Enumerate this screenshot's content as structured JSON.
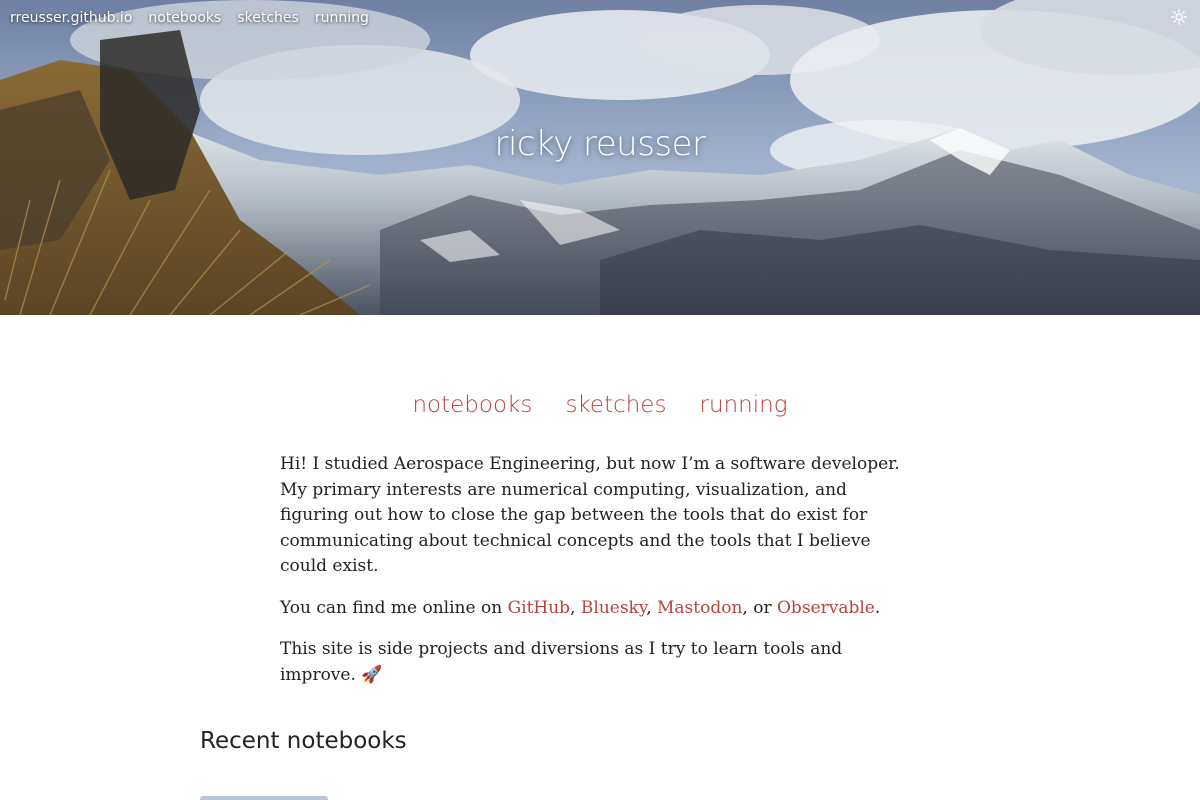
{
  "topnav": {
    "site": "rreusser.github.io",
    "items": [
      "notebooks",
      "sketches",
      "running"
    ]
  },
  "hero": {
    "title": "ricky reusser"
  },
  "main_nav": {
    "items": [
      "notebooks",
      "sketches",
      "running"
    ]
  },
  "intro": {
    "p1": "Hi! I studied Aerospace Engineering, but now I’m a software developer. My primary interests are numerical computing, visualization, and figuring out how to close the gap between the tools that do exist for communicating about technical concepts and the tools that I believe could exist.",
    "p2_prefix": "You can find me online on ",
    "links": [
      "GitHub",
      "Bluesky",
      "Mastodon",
      "Observable"
    ],
    "sep1": ", ",
    "sep2": ", ",
    "sep3": ", or ",
    "p2_suffix": ".",
    "p3": "This site is side projects and diversions as I try to learn tools and improve. 🚀"
  },
  "recent": {
    "title": "Recent notebooks"
  },
  "colors": {
    "accent": "#b8433f",
    "text": "#222222"
  },
  "icons": {
    "theme_toggle": "sun-icon"
  }
}
